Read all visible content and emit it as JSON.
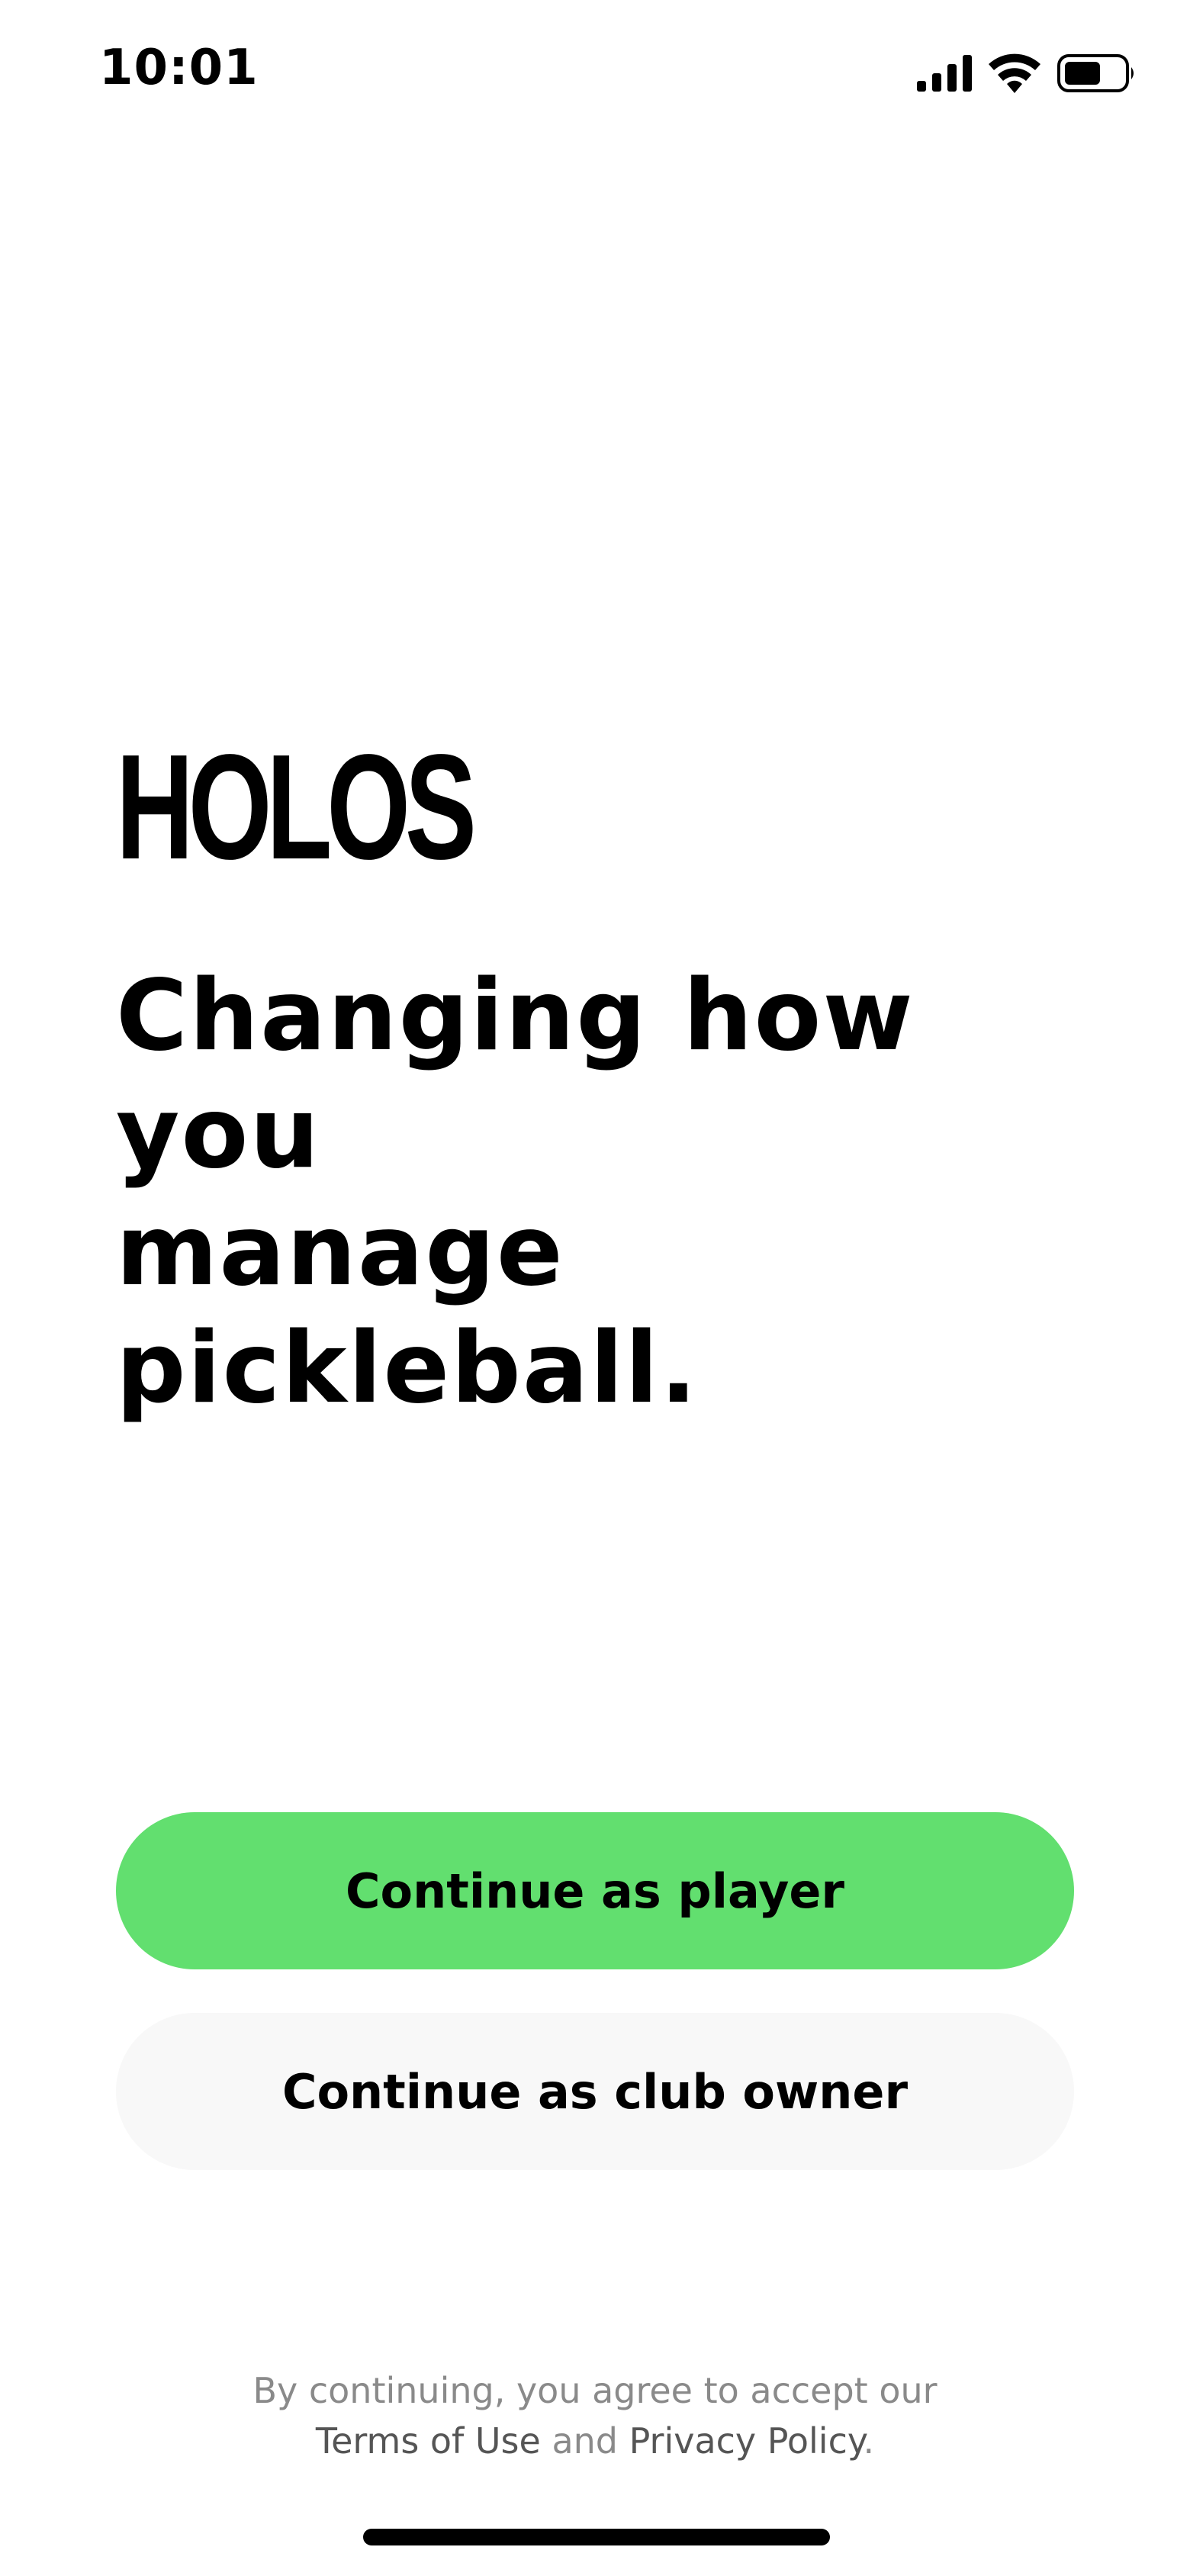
{
  "status_bar": {
    "time": "10:01",
    "icons": [
      "cellular-signal-icon",
      "wifi-icon",
      "battery-icon"
    ]
  },
  "brand": {
    "logo_text": "HOLOS"
  },
  "hero": {
    "headline_line1": "Changing how you",
    "headline_line2": "manage pickleball."
  },
  "actions": {
    "player_label": "Continue as player",
    "club_owner_label": "Continue as club owner"
  },
  "legal": {
    "prefix": "By continuing, you agree to accept our",
    "terms_label": "Terms of Use",
    "and_text": "and",
    "privacy_label": "Privacy Policy",
    "period": "."
  },
  "colors": {
    "primary_button": "#62df6f",
    "secondary_button": "#f8f8f8",
    "text": "#000000",
    "muted_text": "#8a8a8a"
  }
}
